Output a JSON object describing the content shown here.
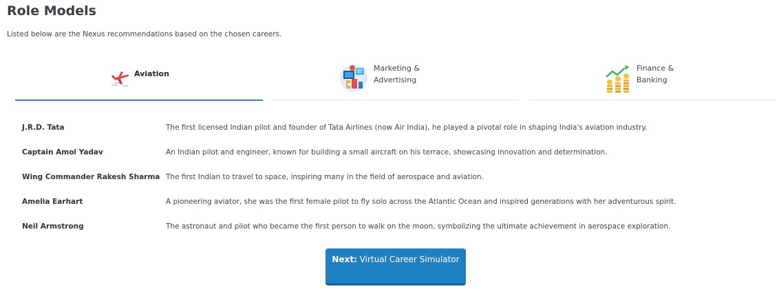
{
  "page": {
    "title": "Role Models",
    "subtitle": "Listed below are the Nexus recommendations based on the chosen careers."
  },
  "tabs": [
    {
      "label_line1": "Aviation",
      "label_line2": "",
      "icon": "airplane-icon",
      "active": true
    },
    {
      "label_line1": "Marketing &",
      "label_line2": "Advertising",
      "icon": "marketing-icon",
      "active": false
    },
    {
      "label_line1": "Finance &",
      "label_line2": "Banking",
      "icon": "finance-icon",
      "active": false
    }
  ],
  "roles": [
    {
      "name": "J.R.D. Tata",
      "description": "The first licensed Indian pilot and founder of Tata Airlines (now Air India), he played a pivotal role in shaping India's aviation industry."
    },
    {
      "name": "Captain Amol Yadav",
      "description": "An Indian pilot and engineer, known for building a small aircraft on his terrace, showcasing innovation and determination."
    },
    {
      "name": "Wing Commander Rakesh Sharma",
      "description": "The first Indian to travel to space, inspiring many in the field of aerospace and aviation."
    },
    {
      "name": "Amelia Earhart",
      "description": "A pioneering aviator, she was the first female pilot to fly solo across the Atlantic Ocean and inspired generations with her adventurous spirit."
    },
    {
      "name": "Neil Armstrong",
      "description": "The astronaut and pilot who became the first person to walk on the moon, symbolizing the ultimate achievement in aerospace exploration."
    }
  ],
  "next_button": {
    "prefix": "Next:",
    "label": "Virtual Career Simulator"
  },
  "colors": {
    "accent": "#1f80c2",
    "tab_active_underline": "#3a7bbf"
  }
}
